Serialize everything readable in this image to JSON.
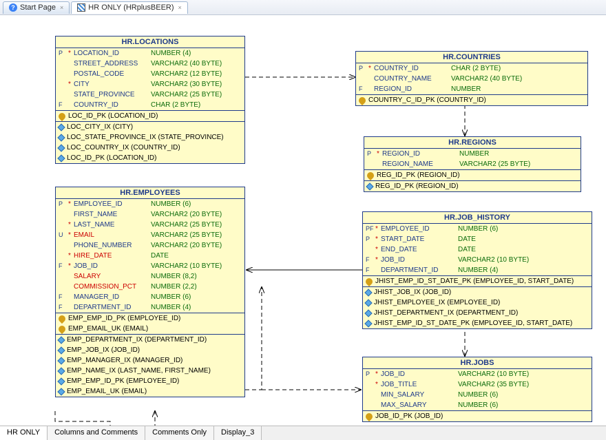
{
  "tabs_top": {
    "start": "Start Page",
    "active": "HR ONLY (HRplusBEER)"
  },
  "tabs_bottom": [
    "HR ONLY",
    "Columns and Comments",
    "Comments Only",
    "Display_3"
  ],
  "entities": {
    "locations": {
      "title": "HR.LOCATIONS",
      "columns": [
        {
          "ind": "P",
          "star": "*",
          "name": "LOCATION_ID",
          "type": "NUMBER (4)"
        },
        {
          "ind": "",
          "star": "",
          "name": "STREET_ADDRESS",
          "type": "VARCHAR2 (40 BYTE)"
        },
        {
          "ind": "",
          "star": "",
          "name": "POSTAL_CODE",
          "type": "VARCHAR2 (12 BYTE)"
        },
        {
          "ind": "",
          "star": "*",
          "name": "CITY",
          "type": "VARCHAR2 (30 BYTE)"
        },
        {
          "ind": "",
          "star": "",
          "name": "STATE_PROVINCE",
          "type": "VARCHAR2 (25 BYTE)"
        },
        {
          "ind": "F",
          "star": "",
          "name": "COUNTRY_ID",
          "type": "CHAR (2 BYTE)"
        }
      ],
      "keys": [
        "LOC_ID_PK (LOCATION_ID)"
      ],
      "indexes": [
        "LOC_CITY_IX (CITY)",
        "LOC_STATE_PROVINCE_IX (STATE_PROVINCE)",
        "LOC_COUNTRY_IX (COUNTRY_ID)",
        "LOC_ID_PK (LOCATION_ID)"
      ]
    },
    "countries": {
      "title": "HR.COUNTRIES",
      "columns": [
        {
          "ind": "P",
          "star": "*",
          "name": "COUNTRY_ID",
          "type": "CHAR (2 BYTE)"
        },
        {
          "ind": "",
          "star": "",
          "name": "COUNTRY_NAME",
          "type": "VARCHAR2 (40 BYTE)"
        },
        {
          "ind": "F",
          "star": "",
          "name": "REGION_ID",
          "type": "NUMBER"
        }
      ],
      "keys": [
        "COUNTRY_C_ID_PK (COUNTRY_ID)"
      ]
    },
    "regions": {
      "title": "HR.REGIONS",
      "columns": [
        {
          "ind": "P",
          "star": "*",
          "name": "REGION_ID",
          "type": "NUMBER"
        },
        {
          "ind": "",
          "star": "",
          "name": "REGION_NAME",
          "type": "VARCHAR2 (25 BYTE)"
        }
      ],
      "keys": [
        "REG_ID_PK (REGION_ID)"
      ],
      "indexes": [
        "REG_ID_PK (REGION_ID)"
      ]
    },
    "employees": {
      "title": "HR.EMPLOYEES",
      "columns": [
        {
          "ind": "P",
          "star": "*",
          "name": "EMPLOYEE_ID",
          "type": "NUMBER (6)"
        },
        {
          "ind": "",
          "star": "",
          "name": "FIRST_NAME",
          "type": "VARCHAR2 (20 BYTE)"
        },
        {
          "ind": "",
          "star": "*",
          "name": "LAST_NAME",
          "type": "VARCHAR2 (25 BYTE)"
        },
        {
          "ind": "U",
          "star": "*",
          "name": "EMAIL",
          "type": "VARCHAR2 (25 BYTE)",
          "red": true
        },
        {
          "ind": "",
          "star": "",
          "name": "PHONE_NUMBER",
          "type": "VARCHAR2 (20 BYTE)"
        },
        {
          "ind": "",
          "star": "*",
          "name": "HIRE_DATE",
          "type": "DATE",
          "red": true
        },
        {
          "ind": "F",
          "star": "*",
          "name": "JOB_ID",
          "type": "VARCHAR2 (10 BYTE)"
        },
        {
          "ind": "",
          "star": "",
          "name": "SALARY",
          "type": "NUMBER (8,2)",
          "red": true
        },
        {
          "ind": "",
          "star": "",
          "name": "COMMISSION_PCT",
          "type": "NUMBER (2,2)",
          "red": true
        },
        {
          "ind": "F",
          "star": "",
          "name": "MANAGER_ID",
          "type": "NUMBER (6)"
        },
        {
          "ind": "F",
          "star": "",
          "name": "DEPARTMENT_ID",
          "type": "NUMBER (4)"
        }
      ],
      "keys": [
        "EMP_EMP_ID_PK (EMPLOYEE_ID)",
        "EMP_EMAIL_UK (EMAIL)"
      ],
      "indexes": [
        "EMP_DEPARTMENT_IX (DEPARTMENT_ID)",
        "EMP_JOB_IX (JOB_ID)",
        "EMP_MANAGER_IX (MANAGER_ID)",
        "EMP_NAME_IX (LAST_NAME, FIRST_NAME)",
        "EMP_EMP_ID_PK (EMPLOYEE_ID)",
        "EMP_EMAIL_UK (EMAIL)"
      ]
    },
    "job_history": {
      "title": "HR.JOB_HISTORY",
      "columns": [
        {
          "ind": "PF",
          "star": "*",
          "name": "EMPLOYEE_ID",
          "type": "NUMBER (6)"
        },
        {
          "ind": "P",
          "star": "*",
          "name": "START_DATE",
          "type": "DATE"
        },
        {
          "ind": "",
          "star": "*",
          "name": "END_DATE",
          "type": "DATE"
        },
        {
          "ind": "F",
          "star": "*",
          "name": "JOB_ID",
          "type": "VARCHAR2 (10 BYTE)"
        },
        {
          "ind": "F",
          "star": "",
          "name": "DEPARTMENT_ID",
          "type": "NUMBER (4)"
        }
      ],
      "keys": [
        "JHIST_EMP_ID_ST_DATE_PK (EMPLOYEE_ID, START_DATE)"
      ],
      "indexes": [
        "JHIST_JOB_IX (JOB_ID)",
        "JHIST_EMPLOYEE_IX (EMPLOYEE_ID)",
        "JHIST_DEPARTMENT_IX (DEPARTMENT_ID)",
        "JHIST_EMP_ID_ST_DATE_PK (EMPLOYEE_ID, START_DATE)"
      ]
    },
    "jobs": {
      "title": "HR.JOBS",
      "columns": [
        {
          "ind": "P",
          "star": "*",
          "name": "JOB_ID",
          "type": "VARCHAR2 (10 BYTE)"
        },
        {
          "ind": "",
          "star": "*",
          "name": "JOB_TITLE",
          "type": "VARCHAR2 (35 BYTE)"
        },
        {
          "ind": "",
          "star": "",
          "name": "MIN_SALARY",
          "type": "NUMBER (6)"
        },
        {
          "ind": "",
          "star": "",
          "name": "MAX_SALARY",
          "type": "NUMBER (6)"
        }
      ],
      "keys": [
        "JOB_ID_PK (JOB_ID)"
      ]
    }
  }
}
